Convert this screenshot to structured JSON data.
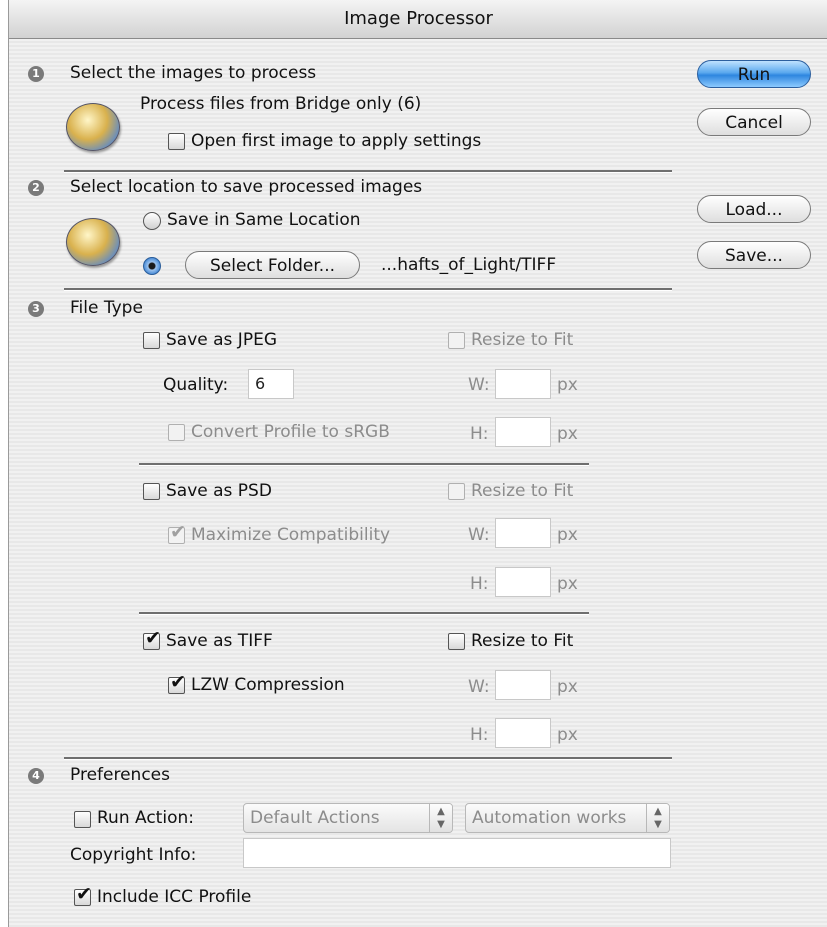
{
  "window": {
    "title": "Image Processor"
  },
  "step1": {
    "number": "1",
    "heading": "Select the images to process",
    "source_text": "Process files from Bridge only (6)",
    "open_first_label": "Open first image to apply settings",
    "open_first_checked": false,
    "icon": "bridge-icon"
  },
  "step2": {
    "number": "2",
    "heading": "Select location to save processed images",
    "same_location_label": "Save in Same Location",
    "same_location_selected": false,
    "select_folder_selected": true,
    "select_folder_button": "Select Folder...",
    "folder_path": "...hafts_of_Light/TIFF",
    "icon": "folder-icon"
  },
  "step3": {
    "number": "3",
    "heading": "File Type",
    "jpeg": {
      "save_label": "Save as JPEG",
      "checked": false,
      "quality_label": "Quality:",
      "quality_value": "6",
      "convert_label": "Convert Profile to sRGB",
      "convert_checked": false,
      "resize_label": "Resize to Fit",
      "resize_checked": false,
      "w_label": "W:",
      "h_label": "H:",
      "w_value": "",
      "h_value": "",
      "px": "px"
    },
    "psd": {
      "save_label": "Save as PSD",
      "checked": false,
      "max_compat_label": "Maximize Compatibility",
      "max_compat_checked": true,
      "resize_label": "Resize to Fit",
      "resize_checked": false,
      "w_label": "W:",
      "h_label": "H:",
      "w_value": "",
      "h_value": "",
      "px": "px"
    },
    "tiff": {
      "save_label": "Save as TIFF",
      "checked": true,
      "lzw_label": "LZW Compression",
      "lzw_checked": true,
      "resize_label": "Resize to Fit",
      "resize_checked": false,
      "w_label": "W:",
      "h_label": "H:",
      "w_value": "",
      "h_value": "",
      "px": "px"
    }
  },
  "step4": {
    "number": "4",
    "heading": "Preferences",
    "run_action_label": "Run Action:",
    "run_action_checked": false,
    "action_set": "Default Actions",
    "action": "Automation works",
    "copyright_label": "Copyright Info:",
    "copyright_value": "",
    "icc_label": "Include ICC Profile",
    "icc_checked": true
  },
  "buttons": {
    "run": "Run",
    "cancel": "Cancel",
    "load": "Load...",
    "save": "Save..."
  },
  "colors": {
    "default_button": "#2e86df",
    "radio_selected": "#4f8fd8"
  }
}
